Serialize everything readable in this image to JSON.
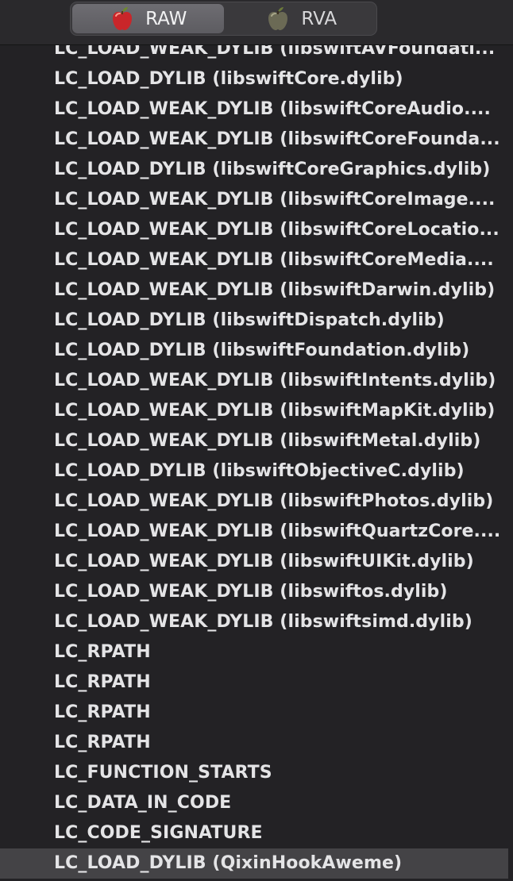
{
  "segmented": {
    "items": [
      {
        "label": "RAW",
        "icon": "apple-red-icon",
        "active": true
      },
      {
        "label": "RVA",
        "icon": "apple-gray-icon",
        "active": false
      }
    ]
  },
  "list": {
    "items": [
      "LC_LOAD_WEAK_DYLIB (libswiftAVFoundati...",
      "LC_LOAD_DYLIB (libswiftCore.dylib)",
      "LC_LOAD_WEAK_DYLIB (libswiftCoreAudio....",
      "LC_LOAD_WEAK_DYLIB (libswiftCoreFounda...",
      "LC_LOAD_DYLIB (libswiftCoreGraphics.dylib)",
      "LC_LOAD_WEAK_DYLIB (libswiftCoreImage....",
      "LC_LOAD_WEAK_DYLIB (libswiftCoreLocatio...",
      "LC_LOAD_WEAK_DYLIB (libswiftCoreMedia....",
      "LC_LOAD_WEAK_DYLIB (libswiftDarwin.dylib)",
      "LC_LOAD_DYLIB (libswiftDispatch.dylib)",
      "LC_LOAD_DYLIB (libswiftFoundation.dylib)",
      "LC_LOAD_WEAK_DYLIB (libswiftIntents.dylib)",
      "LC_LOAD_WEAK_DYLIB (libswiftMapKit.dylib)",
      "LC_LOAD_WEAK_DYLIB (libswiftMetal.dylib)",
      "LC_LOAD_DYLIB (libswiftObjectiveC.dylib)",
      "LC_LOAD_WEAK_DYLIB (libswiftPhotos.dylib)",
      "LC_LOAD_WEAK_DYLIB (libswiftQuartzCore....",
      "LC_LOAD_WEAK_DYLIB (libswiftUIKit.dylib)",
      "LC_LOAD_WEAK_DYLIB (libswiftos.dylib)",
      "LC_LOAD_WEAK_DYLIB (libswiftsimd.dylib)",
      "LC_RPATH",
      "LC_RPATH",
      "LC_RPATH",
      "LC_RPATH",
      "LC_FUNCTION_STARTS",
      "LC_DATA_IN_CODE",
      "LC_CODE_SIGNATURE",
      "LC_LOAD_DYLIB (QixinHookAweme)"
    ],
    "selected_index": 27
  }
}
